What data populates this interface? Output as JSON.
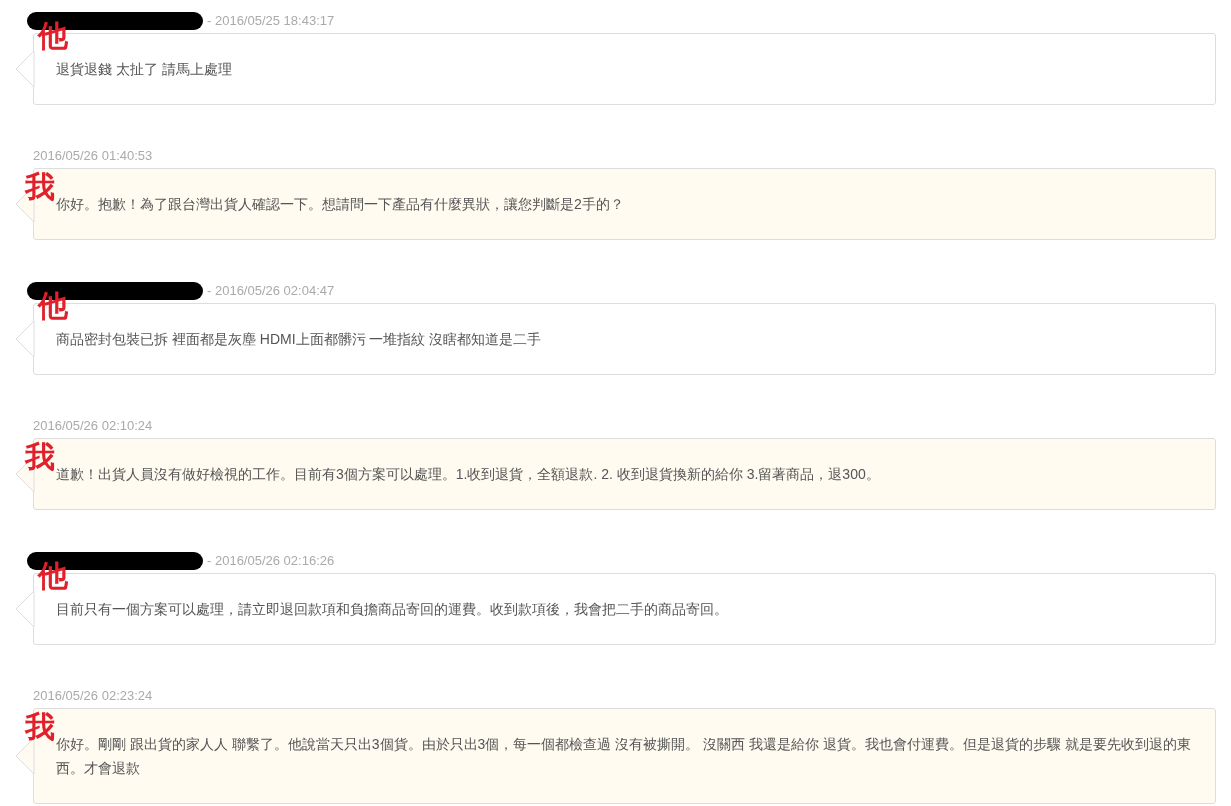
{
  "messages": [
    {
      "kind": "them",
      "marker": "他",
      "meta": "- 2016/05/25 18:43:17",
      "body": "退貨退錢 太扯了 請馬上處理"
    },
    {
      "kind": "me",
      "marker": "我",
      "meta": "2016/05/26 01:40:53",
      "body": "你好。抱歉！為了跟台灣出貨人確認一下。想請問一下產品有什麼異狀，讓您判斷是2手的？"
    },
    {
      "kind": "them",
      "marker": "他",
      "meta": "- 2016/05/26 02:04:47",
      "body": "商品密封包裝已拆 裡面都是灰塵 HDMI上面都髒污 一堆指紋 沒瞎都知道是二手"
    },
    {
      "kind": "me",
      "marker": "我",
      "meta": "2016/05/26 02:10:24",
      "body": "道歉！出貨人員沒有做好檢視的工作。目前有3個方案可以處理。1.收到退貨，全額退款. 2. 收到退貨換新的給你 3.留著商品，退300。"
    },
    {
      "kind": "them",
      "marker": "他",
      "meta": "- 2016/05/26 02:16:26",
      "body": "目前只有一個方案可以處理，請立即退回款項和負擔商品寄回的運費。收到款項後，我會把二手的商品寄回。"
    },
    {
      "kind": "me",
      "marker": "我",
      "meta": "2016/05/26 02:23:24",
      "body": "你好。剛剛 跟出貨的家人人 聯繫了。他說當天只出3個貨。由於只出3個，每一個都檢查過 沒有被撕開。 沒關西 我還是給你 退貨。我也會付運費。但是退貨的步驟 就是要先收到退的東西。才會退款"
    }
  ]
}
